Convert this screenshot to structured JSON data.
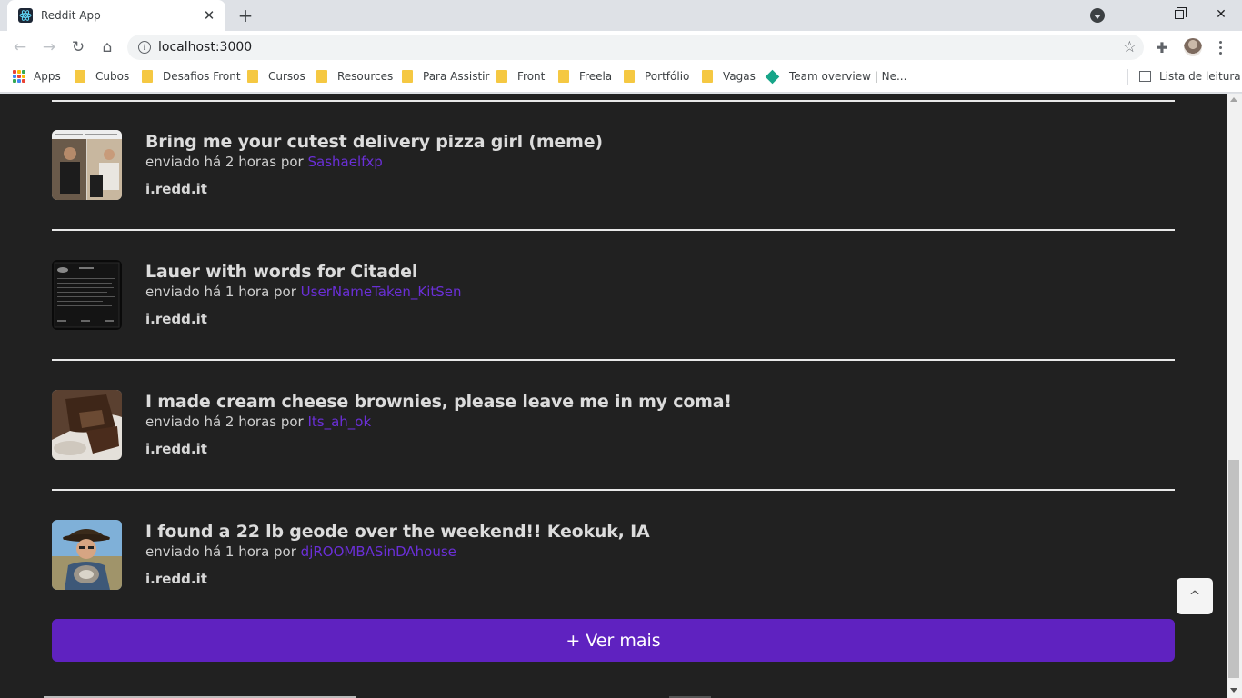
{
  "browser": {
    "tab_title": "Reddit App",
    "url": "localhost:3000",
    "bookmarks": [
      {
        "label": "Apps",
        "icon": "apps-grid-icon"
      },
      {
        "label": "Cubos",
        "icon": "folder-icon"
      },
      {
        "label": "Desafios Front",
        "icon": "folder-icon"
      },
      {
        "label": "Cursos",
        "icon": "folder-icon"
      },
      {
        "label": "Resources",
        "icon": "folder-icon"
      },
      {
        "label": "Para Assistir",
        "icon": "folder-icon"
      },
      {
        "label": "Front",
        "icon": "folder-icon"
      },
      {
        "label": "Freela",
        "icon": "folder-icon"
      },
      {
        "label": "Portfólio",
        "icon": "folder-icon"
      },
      {
        "label": "Vagas",
        "icon": "folder-icon"
      },
      {
        "label": "Team overview | Ne...",
        "icon": "diamond-icon"
      }
    ],
    "reading_list": "Lista de leitura"
  },
  "posts": [
    {
      "title": "Bring me your cutest delivery pizza girl (meme)",
      "meta_prefix": "enviado há 2 horas por ",
      "author": "Sashaelfxp",
      "domain": "i.redd.it",
      "thumb": "meme-photo"
    },
    {
      "title": "Lauer with words for Citadel",
      "meta_prefix": "enviado há 1 hora por ",
      "author": "UserNameTaken_KitSen",
      "domain": "i.redd.it",
      "thumb": "dark-screenshot"
    },
    {
      "title": "I made cream cheese brownies, please leave me in my coma!",
      "meta_prefix": "enviado há 2 horas por ",
      "author": "Its_ah_ok",
      "domain": "i.redd.it",
      "thumb": "brownie-photo"
    },
    {
      "title": "I found a 22 lb geode over the weekend!! Keokuk, IA",
      "meta_prefix": "enviado há 1 hora por ",
      "author": "djROOMBASinDAhouse",
      "domain": "i.redd.it",
      "thumb": "geode-photo"
    }
  ],
  "see_more_label": "+ Ver mais",
  "scroll_top_label": "^",
  "colors": {
    "page_bg": "#212121",
    "accent": "#5f22c0",
    "author_link": "#6a2fd6"
  }
}
